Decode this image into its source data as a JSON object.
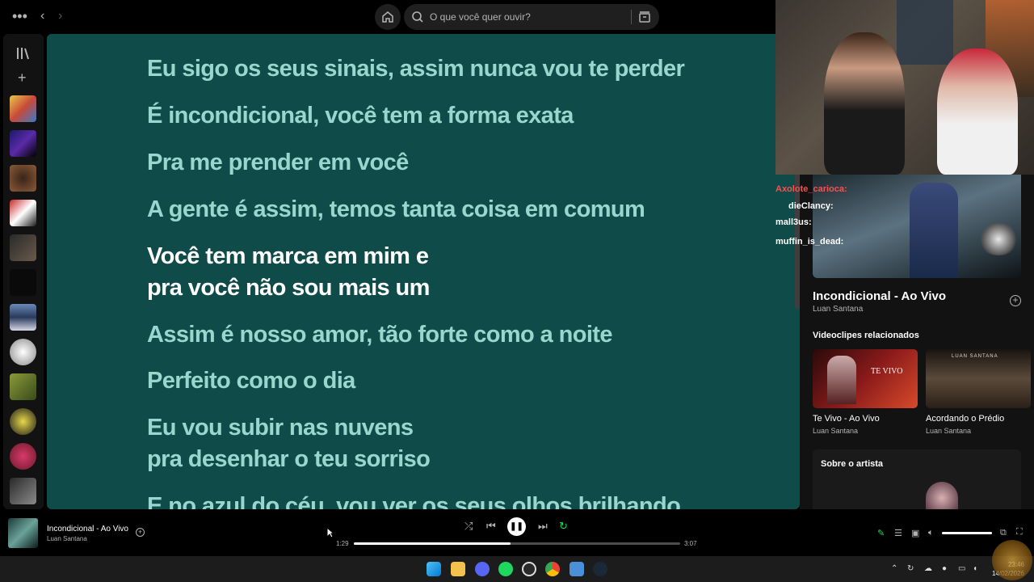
{
  "topbar": {
    "search_placeholder": "O que você quer ouvir?",
    "icons": [
      "more-icon",
      "back-icon",
      "forward-icon",
      "home-icon",
      "search-icon",
      "browse-icon"
    ]
  },
  "sidebar": {
    "icons": [
      "library-icon",
      "plus-icon"
    ],
    "playlist_count": 12
  },
  "lyrics": {
    "lines": [
      {
        "text": "Eu sigo os seus sinais, assim nunca vou te perder",
        "active": false
      },
      {
        "text": "É incondicional, você tem a forma exata",
        "active": false
      },
      {
        "text": "Pra me prender em você",
        "active": false
      },
      {
        "text": "A gente é assim, temos tanta coisa em comum",
        "active": false
      },
      {
        "text": "Você tem marca em mim e",
        "active": true
      },
      {
        "text": "pra você não sou mais um",
        "active": true
      },
      {
        "text": "Assim é nosso amor, tão forte como a noite",
        "active": false
      },
      {
        "text": "Perfeito como o dia",
        "active": false
      },
      {
        "text": "Eu vou subir nas nuvens",
        "active": false
      },
      {
        "text": "pra desenhar o teu sorriso",
        "active": false
      },
      {
        "text": "E no azul do céu, vou ver os seus olhos brilhando",
        "active": false
      }
    ],
    "colors": {
      "background": "#0f4c49",
      "inactive": "#9ad6cd",
      "active": "#ffffff"
    }
  },
  "chat": [
    {
      "user": "Axolote_carioca:",
      "color": "#ff4d4d"
    },
    {
      "user": "dieClancy:",
      "color": "#ffffff"
    },
    {
      "user": "mall3us:",
      "color": "#ffffff"
    },
    {
      "user": "muffin_is_dead:",
      "color": "#ffffff"
    }
  ],
  "now_playing_panel": {
    "title": "Incondicional - Ao Vivo",
    "artist": "Luan Santana",
    "related_heading": "Videoclipes relacionados",
    "videos": [
      {
        "title": "Te Vivo - Ao Vivo",
        "artist": "Luan Santana",
        "overlay": "TE VIVO"
      },
      {
        "title": "Acordando o Prédio",
        "artist": "Luan Santana",
        "overlay": "LUAN SANTANA"
      }
    ],
    "about_heading": "Sobre o artista"
  },
  "player": {
    "title": "Incondicional - Ao Vivo",
    "artist": "Luan Santana",
    "elapsed": "1:29",
    "duration": "3:07",
    "progress_fraction": 0.48,
    "volume_fraction": 1.0,
    "controls": [
      "shuffle-icon",
      "previous-icon",
      "pause-icon",
      "next-icon",
      "repeat-icon"
    ]
  },
  "taskbar": {
    "time": "23:46",
    "date": "14/02/2026",
    "apps": [
      "windows-start-icon",
      "file-explorer-icon",
      "discord-icon",
      "spotify-icon",
      "obs-icon",
      "chrome-icon",
      "notepad-icon",
      "steam-icon"
    ]
  },
  "accent": "#1ed760"
}
